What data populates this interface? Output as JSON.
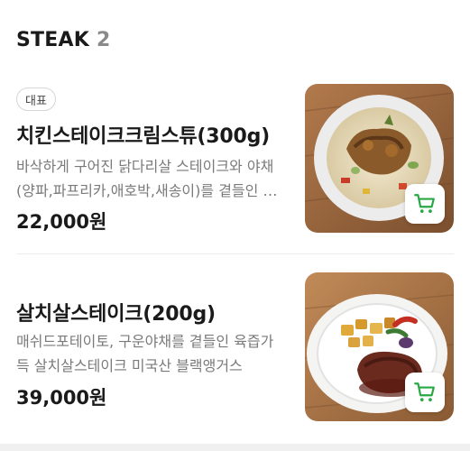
{
  "section": {
    "title": "STEAK",
    "count": "2"
  },
  "items": [
    {
      "badge": "대표",
      "name": "치킨스테이크크림스튜(300g)",
      "description": "바삭하게 구어진 닭다리살 스테이크와 야채(양파,파프리카,애호박,새송이)를 곁들인 크림스튜",
      "price": "22,000원",
      "image_icon": "chicken-steak-cream-stew-photo",
      "cart_icon": "cart-icon"
    },
    {
      "name": "살치살스테이크(200g)",
      "description": "매쉬드포테이토, 구운야채를 곁들인 육즙가득 살치살스테이크 미국산 블랙앵거스",
      "price": "39,000원",
      "image_icon": "chuck-flap-steak-photo",
      "cart_icon": "cart-icon"
    }
  ],
  "colors": {
    "accent": "#27a844",
    "muted": "#7a7a7a"
  }
}
